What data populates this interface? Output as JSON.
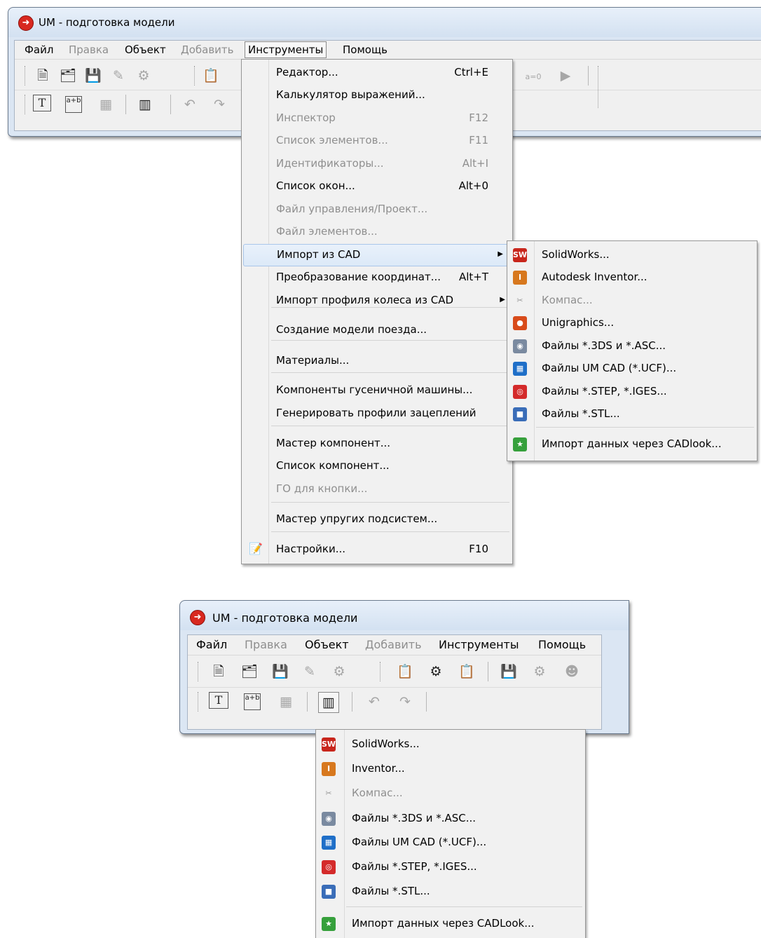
{
  "window": {
    "title": "UM - подготовка модели",
    "app_icon": "um-app-icon"
  },
  "menubar": {
    "file": "Файл",
    "edit": "Правка",
    "object": "Объект",
    "add": "Добавить",
    "tools": "Инструменты",
    "help": "Помощь"
  },
  "toolbar_icons": {
    "text": "T",
    "ab": "a+b",
    "a0": "a=0"
  },
  "tools_menu": {
    "items": [
      {
        "label": "Редактор...",
        "shortcut": "Ctrl+E",
        "enabled": true
      },
      {
        "label": "Калькулятор выражений...",
        "shortcut": "",
        "enabled": true
      },
      {
        "label": "Инспектор",
        "shortcut": "F12",
        "enabled": false
      },
      {
        "label": "Список элементов...",
        "shortcut": "F11",
        "enabled": false
      },
      {
        "label": "Идентификаторы...",
        "shortcut": "Alt+I",
        "enabled": false
      },
      {
        "label": "Список окон...",
        "shortcut": "Alt+0",
        "enabled": true
      },
      {
        "label": "Файл управления/Проект...",
        "shortcut": "",
        "enabled": false
      },
      {
        "label": "Файл элементов...",
        "shortcut": "",
        "enabled": false
      },
      {
        "label": "Импорт из CAD",
        "shortcut": "",
        "enabled": true
      },
      {
        "label": "Преобразование координат...",
        "shortcut": "Alt+T",
        "enabled": true
      },
      {
        "label": "Импорт профиля колеса из CAD",
        "shortcut": "",
        "enabled": true
      },
      {
        "label": "Создание модели поезда...",
        "shortcut": "",
        "enabled": true
      },
      {
        "label": "Материалы...",
        "shortcut": "",
        "enabled": true
      },
      {
        "label": "Компоненты гусеничной машины...",
        "shortcut": "",
        "enabled": true
      },
      {
        "label": "Генерировать профили зацеплений",
        "shortcut": "",
        "enabled": true
      },
      {
        "label": "Мастер компонент...",
        "shortcut": "",
        "enabled": true
      },
      {
        "label": "Список компонент...",
        "shortcut": "",
        "enabled": true
      },
      {
        "label": "ГО для кнопки...",
        "shortcut": "",
        "enabled": false
      },
      {
        "label": "Мастер упругих подсистем...",
        "shortcut": "",
        "enabled": true
      },
      {
        "label": "Настройки...",
        "shortcut": "F10",
        "enabled": true
      }
    ]
  },
  "cad_submenu": {
    "items": [
      {
        "label": "SolidWorks...",
        "icon": "solidworks-icon",
        "enabled": true
      },
      {
        "label": "Autodesk Inventor...",
        "icon": "inventor-icon",
        "enabled": true
      },
      {
        "label": "Компас...",
        "icon": "kompas-icon",
        "enabled": false
      },
      {
        "label": "Unigraphics...",
        "icon": "unigraphics-icon",
        "enabled": true
      },
      {
        "label": "Файлы *.3DS и *.ASC...",
        "icon": "3ds-icon",
        "enabled": true
      },
      {
        "label": "Файлы UM CAD (*.UCF)...",
        "icon": "ucf-icon",
        "enabled": true
      },
      {
        "label": "Файлы *.STEP, *.IGES...",
        "icon": "step-icon",
        "enabled": true
      },
      {
        "label": "Файлы *.STL...",
        "icon": "stl-icon",
        "enabled": true
      },
      {
        "label": "Импорт данных через CADlook...",
        "icon": "cadlook-icon",
        "enabled": true
      }
    ]
  },
  "cad_dropdown": {
    "items": [
      {
        "label": "SolidWorks...",
        "icon": "solidworks-icon",
        "enabled": true
      },
      {
        "label": "Inventor...",
        "icon": "inventor-icon",
        "enabled": true
      },
      {
        "label": "Компас...",
        "icon": "kompas-icon",
        "enabled": false
      },
      {
        "label": "Файлы *.3DS и *.ASC...",
        "icon": "3ds-icon",
        "enabled": true
      },
      {
        "label": "Файлы UM CAD (*.UCF)...",
        "icon": "ucf-icon",
        "enabled": true
      },
      {
        "label": "Файлы *.STEP, *.IGES...",
        "icon": "step-icon",
        "enabled": true
      },
      {
        "label": "Файлы *.STL...",
        "icon": "stl-icon",
        "enabled": true
      },
      {
        "label": "Импорт данных через CADLook...",
        "icon": "cadlook-icon",
        "enabled": true
      }
    ]
  }
}
